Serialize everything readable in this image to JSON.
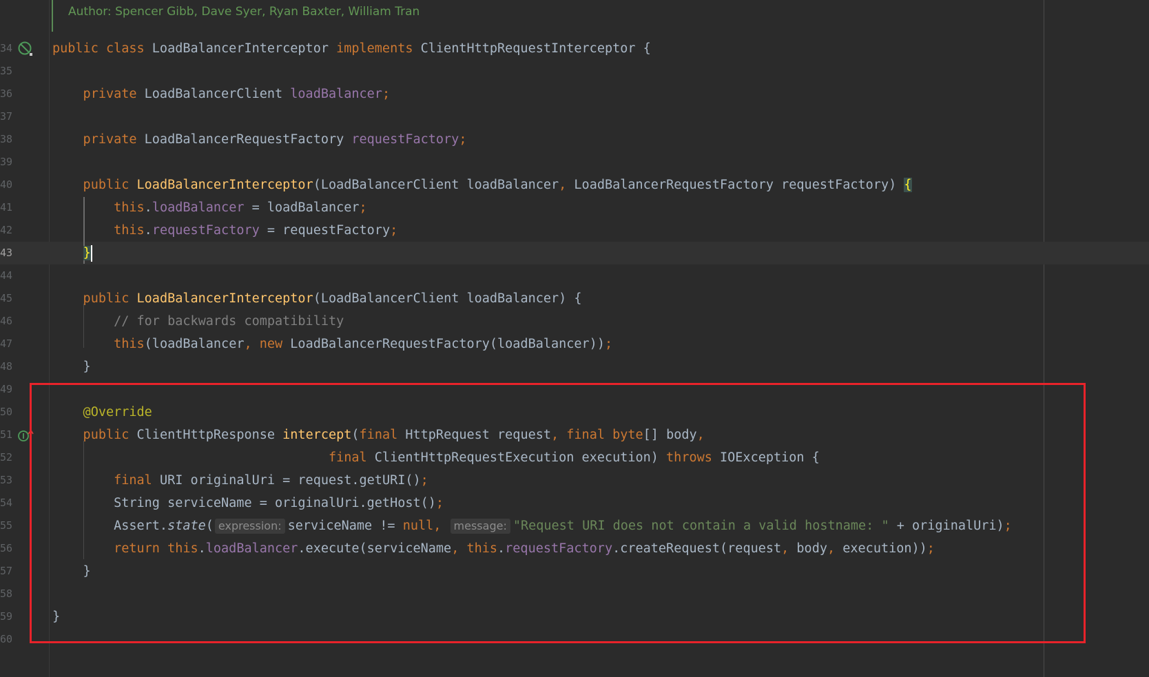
{
  "doc_comment": "Author: Spencer Gibb, Dave Syer, Ryan Baxter, William Tran",
  "icons": [
    "no-gc-root-icon",
    "implements-method-icon"
  ],
  "lines": [
    {
      "n": "34",
      "parts": [
        [
          "kw",
          "public "
        ],
        [
          "kw",
          "class "
        ],
        [
          "",
          "LoadBalancerInterceptor "
        ],
        [
          "kw",
          "implements "
        ],
        [
          "",
          "ClientHttpRequestInterceptor {"
        ]
      ]
    },
    {
      "n": "35",
      "parts": []
    },
    {
      "n": "36",
      "parts": [
        [
          "kw",
          "    private "
        ],
        [
          "",
          "LoadBalancerClient "
        ],
        [
          "fld",
          "loadBalancer"
        ],
        [
          "kw",
          ";"
        ]
      ]
    },
    {
      "n": "37",
      "parts": []
    },
    {
      "n": "38",
      "parts": [
        [
          "kw",
          "    private "
        ],
        [
          "",
          "LoadBalancerRequestFactory "
        ],
        [
          "fld",
          "requestFactory"
        ],
        [
          "kw",
          ";"
        ]
      ]
    },
    {
      "n": "39",
      "parts": []
    },
    {
      "n": "40",
      "parts": [
        [
          "kw",
          "    public "
        ],
        [
          "fn",
          "LoadBalancerInterceptor"
        ],
        [
          "",
          "(LoadBalancerClient loadBalancer"
        ],
        [
          "kw",
          ", "
        ],
        [
          "",
          "LoadBalancerRequestFactory requestFactory) "
        ],
        [
          "brace-hl",
          "{"
        ]
      ]
    },
    {
      "n": "41",
      "parts": [
        [
          "",
          "        "
        ],
        [
          "kw",
          "this"
        ],
        [
          "",
          "."
        ],
        [
          "fld",
          "loadBalancer"
        ],
        [
          "",
          " = loadBalancer"
        ],
        [
          "kw",
          ";"
        ]
      ]
    },
    {
      "n": "42",
      "parts": [
        [
          "",
          "        "
        ],
        [
          "kw",
          "this"
        ],
        [
          "",
          "."
        ],
        [
          "fld",
          "requestFactory"
        ],
        [
          "",
          " = requestFactory"
        ],
        [
          "kw",
          ";"
        ]
      ]
    },
    {
      "n": "43",
      "current": true,
      "parts": [
        [
          "",
          "    "
        ],
        [
          "brace-hl",
          "}"
        ],
        [
          "caret",
          ""
        ]
      ]
    },
    {
      "n": "44",
      "parts": []
    },
    {
      "n": "45",
      "parts": [
        [
          "kw",
          "    public "
        ],
        [
          "fn",
          "LoadBalancerInterceptor"
        ],
        [
          "",
          "(LoadBalancerClient loadBalancer) {"
        ]
      ]
    },
    {
      "n": "46",
      "parts": [
        [
          "cm",
          "        // for backwards compatibility"
        ]
      ]
    },
    {
      "n": "47",
      "parts": [
        [
          "",
          "        "
        ],
        [
          "kw",
          "this"
        ],
        [
          "",
          "(loadBalancer"
        ],
        [
          "kw",
          ", new "
        ],
        [
          "",
          "LoadBalancerRequestFactory(loadBalancer))"
        ],
        [
          "kw",
          ";"
        ]
      ]
    },
    {
      "n": "48",
      "parts": [
        [
          "",
          "    }"
        ]
      ]
    },
    {
      "n": "49",
      "parts": []
    },
    {
      "n": "50",
      "parts": [
        [
          "ann",
          "    @Override"
        ]
      ]
    },
    {
      "n": "51",
      "parts": [
        [
          "kw",
          "    public "
        ],
        [
          "",
          "ClientHttpResponse "
        ],
        [
          "fn",
          "intercept"
        ],
        [
          "",
          "("
        ],
        [
          "kw",
          "final "
        ],
        [
          "",
          "HttpRequest request"
        ],
        [
          "kw",
          ", final byte"
        ],
        [
          "",
          "[] body"
        ],
        [
          "kw",
          ","
        ]
      ]
    },
    {
      "n": "52",
      "parts": [
        [
          "kw",
          "                                    final "
        ],
        [
          "",
          "ClientHttpRequestExecution execution) "
        ],
        [
          "kw",
          "throws "
        ],
        [
          "",
          "IOException {"
        ]
      ]
    },
    {
      "n": "53",
      "parts": [
        [
          "kw",
          "        final "
        ],
        [
          "",
          "URI originalUri = request.getURI()"
        ],
        [
          "kw",
          ";"
        ]
      ]
    },
    {
      "n": "54",
      "parts": [
        [
          "",
          "        String serviceName = originalUri.getHost()"
        ],
        [
          "kw",
          ";"
        ]
      ]
    },
    {
      "n": "55",
      "parts": [
        [
          "",
          "        Assert."
        ],
        [
          "it",
          "state"
        ],
        [
          "",
          "("
        ],
        [
          "hint",
          "expression:"
        ],
        [
          "",
          "serviceName != "
        ],
        [
          "kw",
          "null, "
        ],
        [
          "hint",
          "message:"
        ],
        [
          "str",
          "\"Request URI does not contain a valid hostname: \""
        ],
        [
          "",
          " + originalUri)"
        ],
        [
          "kw",
          ";"
        ]
      ]
    },
    {
      "n": "56",
      "parts": [
        [
          "kw",
          "        return this"
        ],
        [
          "",
          "."
        ],
        [
          "fld",
          "loadBalancer"
        ],
        [
          "",
          ".execute(serviceName"
        ],
        [
          "kw",
          ", this"
        ],
        [
          "",
          "."
        ],
        [
          "fld",
          "requestFactory"
        ],
        [
          "",
          ".createRequest(request"
        ],
        [
          "kw",
          ", "
        ],
        [
          "",
          "body"
        ],
        [
          "kw",
          ", "
        ],
        [
          "",
          "execution))"
        ],
        [
          "kw",
          ";"
        ]
      ]
    },
    {
      "n": "57",
      "parts": [
        [
          "",
          "    }"
        ]
      ]
    },
    {
      "n": "58",
      "parts": []
    },
    {
      "n": "59",
      "parts": [
        [
          "",
          "}"
        ]
      ]
    },
    {
      "n": "60",
      "parts": []
    }
  ]
}
